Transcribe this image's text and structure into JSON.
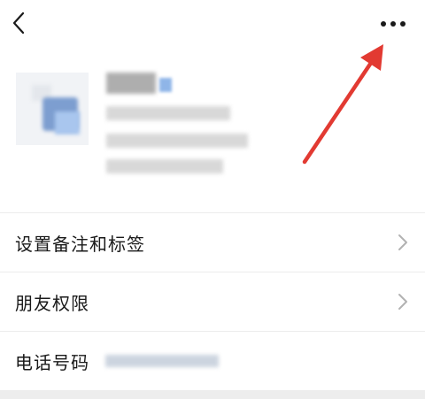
{
  "header": {
    "back_icon": "chevron-left-icon",
    "more_icon": "more-horizontal-icon"
  },
  "profile": {
    "avatar_icon": "avatar-image"
  },
  "rows": [
    {
      "label": "设置备注和标签",
      "has_chevron": true
    },
    {
      "label": "朋友权限",
      "has_chevron": true
    },
    {
      "label": "电话号码",
      "has_chevron": false
    }
  ],
  "colors": {
    "annotation_arrow": "#e23a32",
    "divider": "#ececec",
    "text": "#1a1a1a",
    "chevron": "#b2b2b2",
    "bottom_band": "#ededed"
  }
}
